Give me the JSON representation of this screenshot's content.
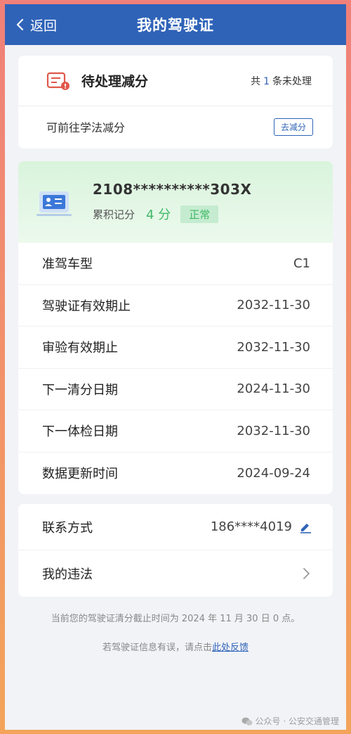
{
  "nav": {
    "back_label": "返回",
    "title": "我的驾驶证"
  },
  "pending": {
    "title": "待处理减分",
    "count_prefix": "共",
    "count": "1",
    "count_suffix": "条未处理",
    "hint": "可前往学法减分",
    "button": "去减分"
  },
  "license": {
    "number": "2108**********303X",
    "points_label": "累积记分",
    "points_value": "4 分",
    "status": "正常",
    "rows": [
      {
        "label": "准驾车型",
        "value": "C1"
      },
      {
        "label": "驾驶证有效期止",
        "value": "2032-11-30"
      },
      {
        "label": "审验有效期止",
        "value": "2032-11-30"
      },
      {
        "label": "下一清分日期",
        "value": "2024-11-30"
      },
      {
        "label": "下一体检日期",
        "value": "2032-11-30"
      },
      {
        "label": "数据更新时间",
        "value": "2024-09-24"
      }
    ]
  },
  "contact": {
    "label": "联系方式",
    "phone": "186****4019",
    "violations_label": "我的违法"
  },
  "notes": {
    "clear_notice": "当前您的驾驶证清分截止时间为 2024 年 11 月 30 日 0 点。",
    "feedback_prefix": "若驾驶证信息有误，请点击",
    "feedback_link": "此处反馈"
  },
  "watermark": {
    "text": "公众号 · 公安交通管理"
  },
  "colors": {
    "nav_blue": "#2f63b8",
    "green": "#3fb866",
    "pending_red": "#e0584a"
  }
}
